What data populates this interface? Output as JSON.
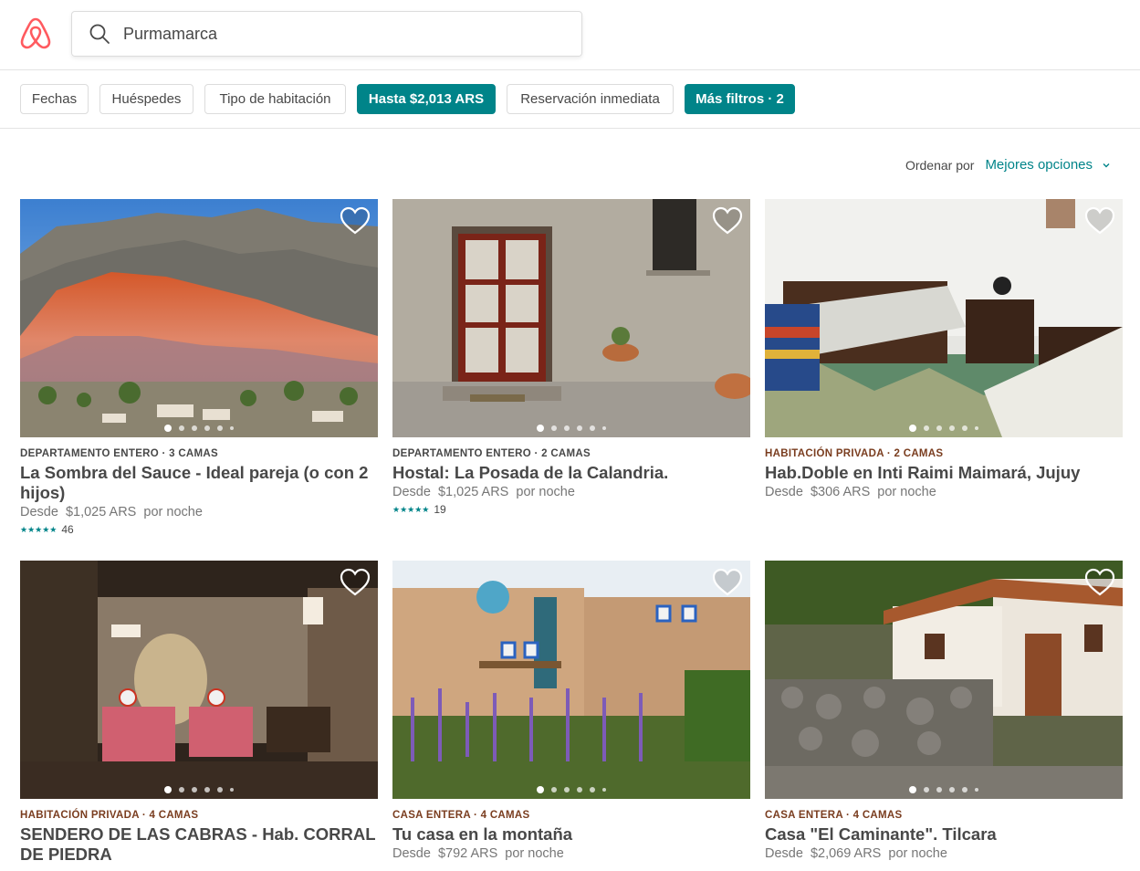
{
  "header": {
    "search_value": "Purmamarca"
  },
  "filters": [
    {
      "label": "Fechas",
      "active": false
    },
    {
      "label": "Huéspedes",
      "active": false
    },
    {
      "label": "Tipo de habitación",
      "active": false
    },
    {
      "label": "Hasta $2,013 ARS",
      "active": true
    },
    {
      "label": "Reservación inmediata",
      "active": false
    },
    {
      "label": "Más filtros · 2",
      "active": true
    }
  ],
  "sort": {
    "label": "Ordenar por",
    "value": "Mejores opciones"
  },
  "listings": [
    {
      "kicker": "DEPARTAMENTO ENTERO · 3 CAMAS",
      "title": "La Sombra del Sauce - Ideal pareja (o con 2 hijos)",
      "price_prefix": "Desde",
      "price": "$1,025 ARS",
      "price_suffix": "por noche",
      "reviews": "46",
      "stars": "★★★★★",
      "photo": "mountain-landscape"
    },
    {
      "kicker": "DEPARTAMENTO ENTERO · 2 CAMAS",
      "title": "Hostal: La Posada de la Calandria.",
      "price_prefix": "Desde",
      "price": "$1,025 ARS",
      "price_suffix": "por noche",
      "reviews": "19",
      "stars": "★★★★★",
      "photo": "adobe-door"
    },
    {
      "kicker": "HABITACIÓN PRIVADA · 2 CAMAS",
      "title": "Hab.Doble en Inti Raimi Maimará, Jujuy",
      "price_prefix": "Desde",
      "price": "$306 ARS",
      "price_suffix": "por noche",
      "photo": "twin-bedroom"
    },
    {
      "kicker": "HABITACIÓN PRIVADA · 4 CAMAS",
      "title": "SENDERO DE LAS CABRAS - Hab. CORRAL DE PIEDRA",
      "photo": "dim-bedroom"
    },
    {
      "kicker": "CASA ENTERA · 4 CAMAS",
      "title": "Tu casa en la montaña",
      "price_prefix": "Desde",
      "price": "$792 ARS",
      "price_suffix": "por noche",
      "photo": "garden-house"
    },
    {
      "kicker": "CASA ENTERA · 4 CAMAS",
      "title": "Casa \"El Caminante\". Tilcara",
      "price_prefix": "Desde",
      "price": "$2,069 ARS",
      "price_suffix": "por noche",
      "photo": "stone-house"
    }
  ],
  "colors": {
    "accent": "#008489",
    "brand": "#FF5A5F",
    "text": "#484848",
    "muted": "#767676"
  }
}
